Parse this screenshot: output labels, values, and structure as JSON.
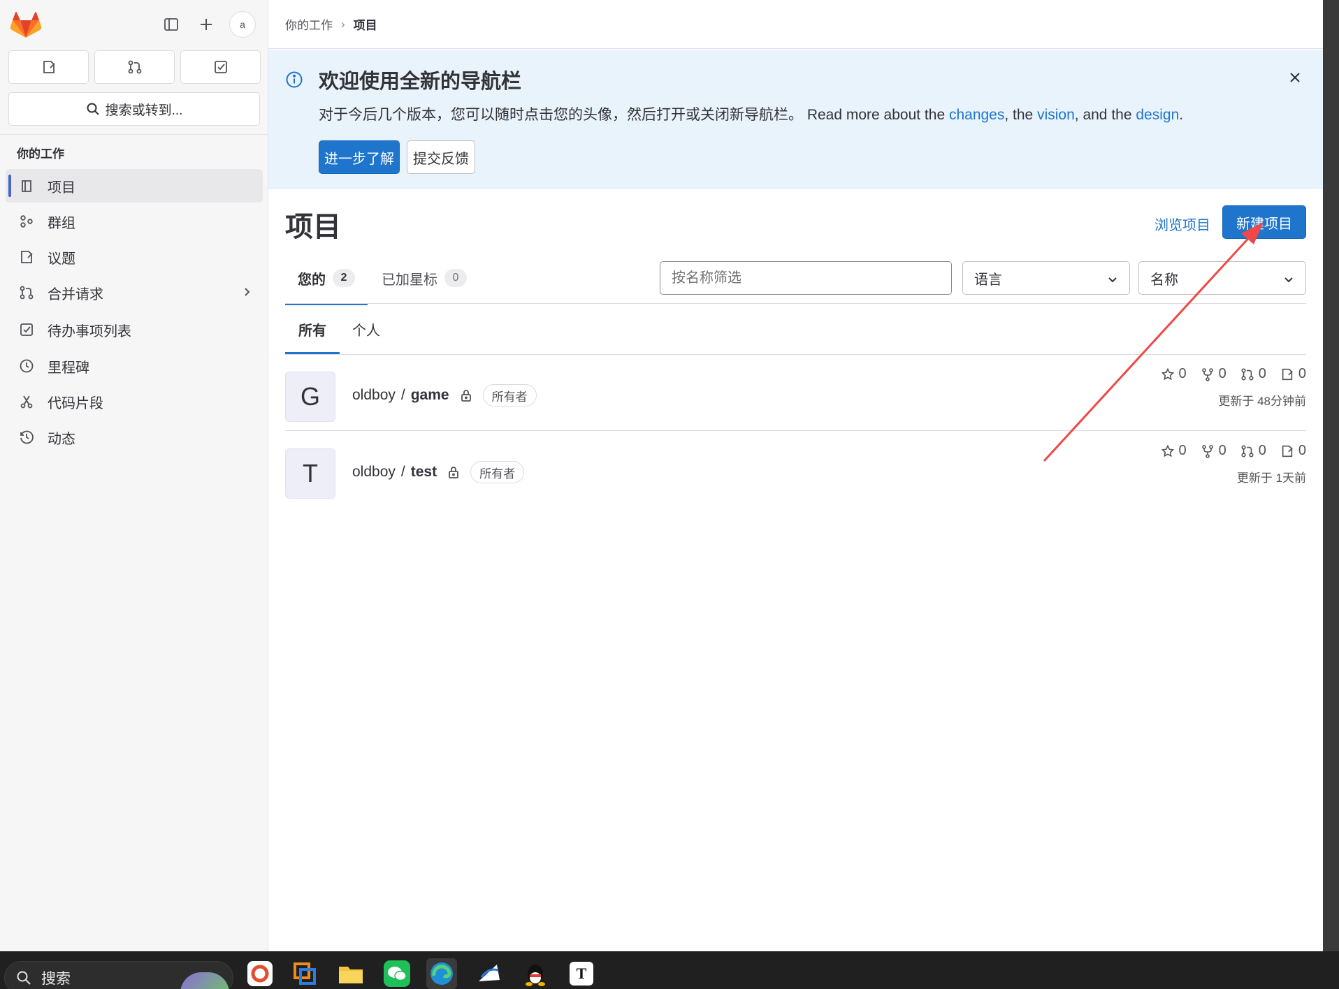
{
  "sidebar": {
    "search_label": "搜索或转到...",
    "section_title": "你的工作",
    "avatar_alt": "a",
    "items": [
      {
        "label": "项目",
        "icon": "project-icon"
      },
      {
        "label": "群组",
        "icon": "group-icon"
      },
      {
        "label": "议题",
        "icon": "issues-icon"
      },
      {
        "label": "合并请求",
        "icon": "merge-request-icon"
      },
      {
        "label": "待办事项列表",
        "icon": "todo-icon"
      },
      {
        "label": "里程碑",
        "icon": "clock-icon"
      },
      {
        "label": "代码片段",
        "icon": "snippet-icon"
      },
      {
        "label": "动态",
        "icon": "history-icon"
      }
    ]
  },
  "breadcrumb": {
    "parent": "你的工作",
    "current": "项目"
  },
  "banner": {
    "title": "欢迎使用全新的导航栏",
    "text_before": "对于今后几个版本，您可以随时点击您的头像，然后打开或关闭新导航栏。 Read more about the ",
    "link_changes": "changes",
    "text_mid1": ", the ",
    "link_vision": "vision",
    "text_mid2": ", and the ",
    "link_design": "design",
    "text_end": ".",
    "learn_more": "进一步了解",
    "feedback": "提交反馈"
  },
  "page": {
    "title": "项目",
    "explore": "浏览项目",
    "new_project": "新建项目"
  },
  "filters": {
    "tab_yours": "您的",
    "tab_yours_count": "2",
    "tab_starred": "已加星标",
    "tab_starred_count": "0",
    "search_placeholder": "按名称筛选",
    "language": "语言",
    "sort": "名称"
  },
  "subtabs": {
    "all": "所有",
    "personal": "个人"
  },
  "projects": [
    {
      "initial": "G",
      "namespace": "oldboy",
      "name": "game",
      "role": "所有者",
      "stars": "0",
      "forks": "0",
      "mrs": "0",
      "issues": "0",
      "updated": "更新于 48分钟前"
    },
    {
      "initial": "T",
      "namespace": "oldboy",
      "name": "test",
      "role": "所有者",
      "stars": "0",
      "forks": "0",
      "mrs": "0",
      "issues": "0",
      "updated": "更新于 1天前"
    }
  ],
  "taskbar": {
    "search": "搜索",
    "typora_letter": "T"
  },
  "colors": {
    "accent": "#1f75cb",
    "banner_bg": "#e9f3fc",
    "annotation_arrow": "#f04848"
  }
}
